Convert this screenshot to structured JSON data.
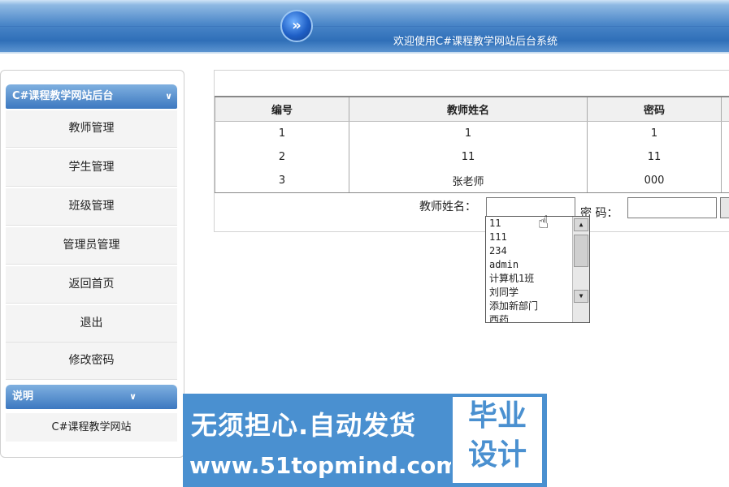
{
  "banner": {
    "logo_glyph": "»",
    "title": "欢迎使用C#课程教学网站后台系统"
  },
  "sidebar": {
    "header": "C#课程教学网站后台",
    "header_icon": "chevron-down-icon",
    "items": [
      {
        "label": "教师管理"
      },
      {
        "label": "学生管理"
      },
      {
        "label": "班级管理"
      },
      {
        "label": "管理员管理"
      },
      {
        "label": "返回首页"
      },
      {
        "label": "退出"
      },
      {
        "label": "修改密码"
      }
    ],
    "info_header": "说明",
    "info_text": "C#课程教学网站"
  },
  "table": {
    "columns": [
      "编号",
      "教师姓名",
      "密码",
      ""
    ],
    "rows": [
      [
        "1",
        "1",
        "1",
        ""
      ],
      [
        "2",
        "11",
        "11",
        ""
      ],
      [
        "3",
        "张老师",
        "000",
        ""
      ]
    ]
  },
  "form": {
    "name_label": "教师姓名：",
    "name_value": "",
    "password_label": "密 码：",
    "password_value": ""
  },
  "autocomplete": {
    "options": [
      "11",
      "111",
      "234",
      "admin",
      "计算机1班",
      "刘同学",
      "添加新部门",
      "西药"
    ]
  },
  "ad": {
    "line1": "无须担心.自动发货",
    "line2": "www.51topmind.com",
    "side_line1": "毕业",
    "side_line2": "设计"
  },
  "colors": {
    "banner_blue": "#2f6fb8",
    "panel_head": "#3c78c0",
    "ad_blue": "#4a90d0"
  }
}
